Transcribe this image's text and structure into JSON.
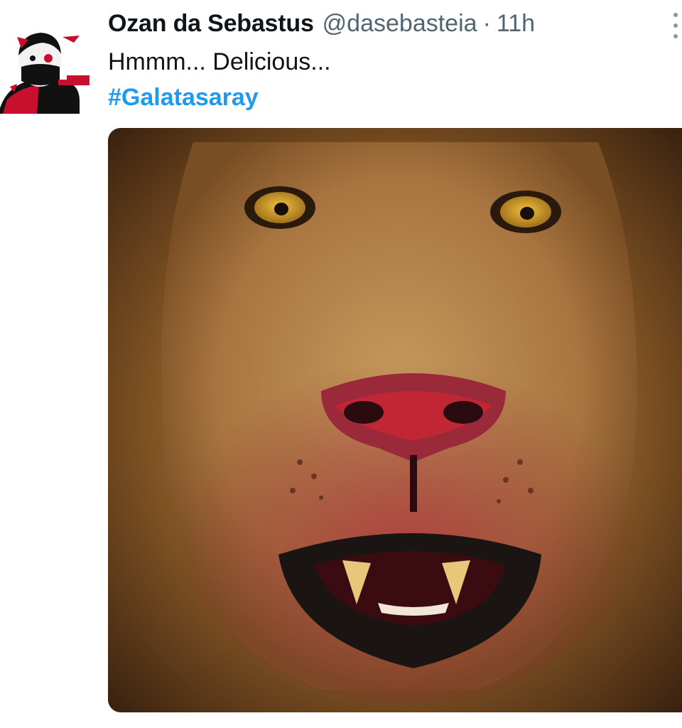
{
  "tweet": {
    "author": {
      "display_name": "Ozan da Sebastus",
      "handle": "@dasebasteia",
      "separator": "·",
      "time": "11h"
    },
    "text": "Hmmm... Delicious...",
    "hashtag": "#Galatasaray",
    "media": {
      "icon": "photo-lion-icon"
    }
  },
  "colors": {
    "name": "#0f1419",
    "secondary": "#536471",
    "link": "#1d9bf0",
    "more_dots": "#8899a6"
  },
  "icons": {
    "avatar": "avatar-icon",
    "more": "more-vertical-icon"
  }
}
